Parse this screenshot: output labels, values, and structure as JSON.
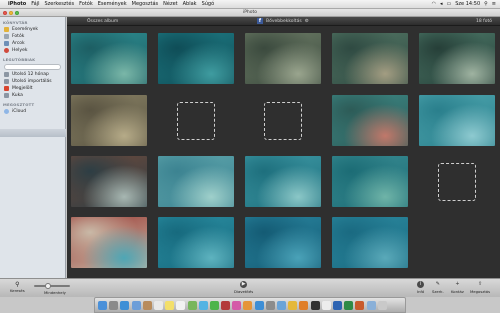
{
  "menubar": {
    "apple_icon": "apple-icon",
    "menus": [
      "iPhoto",
      "Fájl",
      "Szerkesztés",
      "Fotók",
      "Események",
      "Megosztás",
      "Nézet",
      "Ablak",
      "Súgó"
    ],
    "clock": "Sze 14:50"
  },
  "window": {
    "title": "iPhoto"
  },
  "sidebar": {
    "sections": [
      {
        "title": "KÖNYVTÁR",
        "items": [
          {
            "label": "Események",
            "icon": "events-icon",
            "color": "#e2b33a"
          },
          {
            "label": "Fotók",
            "icon": "photos-icon",
            "color": "#9aa6b3"
          },
          {
            "label": "Arcok",
            "icon": "faces-icon",
            "color": "#6d8fb7"
          },
          {
            "label": "Helyek",
            "icon": "places-icon",
            "color": "#d04a3c"
          }
        ]
      },
      {
        "title": "LEGUTÓBBIAK",
        "items": [
          {
            "label": "Utolsó 12 hónap",
            "icon": "calendar-icon",
            "color": "#8b96a3"
          },
          {
            "label": "Utolsó importálás",
            "icon": "import-icon",
            "color": "#8b96a3"
          },
          {
            "label": "Megjelölt",
            "icon": "flag-icon",
            "color": "#d9452f"
          },
          {
            "label": "Kuka",
            "icon": "trash-icon",
            "color": "#8b96a3"
          }
        ]
      },
      {
        "title": "MEGOSZTOTT",
        "items": [
          {
            "label": "iCloud",
            "icon": "icloud-icon",
            "color": "#8fb6e6"
          }
        ]
      }
    ]
  },
  "toolbar": {
    "album_name": "Összes album",
    "share_label": "Bővebbekkoltás",
    "count": "18 fotó"
  },
  "photos": [
    {
      "name": "photo-diver-1",
      "colors": [
        "#2e8f93",
        "#1d5e63",
        "#7ab7a8"
      ]
    },
    {
      "name": "photo-diver-2",
      "colors": [
        "#1f7c85",
        "#0f4d57",
        "#3f9ca0"
      ]
    },
    {
      "name": "photo-reef-1",
      "colors": [
        "#6f7e68",
        "#3b4a3e",
        "#9aa58e"
      ]
    },
    {
      "name": "photo-reef-2",
      "colors": [
        "#547765",
        "#2f4a42",
        "#a39d82"
      ]
    },
    {
      "name": "photo-reef-3",
      "colors": [
        "#4e7a6a",
        "#263f38",
        "#9fb3a1"
      ]
    },
    {
      "name": "photo-rocks-1",
      "colors": [
        "#8a8366",
        "#5a5442",
        "#b6ab88"
      ]
    },
    {
      "name": "photo-coral-1",
      "colors": [
        "#3d8a87",
        "#2d5b57",
        "#c1786a"
      ]
    },
    {
      "name": "photo-shallow-1",
      "colors": [
        "#4fa7b0",
        "#2a7f8c",
        "#8ecad0"
      ]
    },
    {
      "name": "photo-rock-diver",
      "colors": [
        "#6e4a3c",
        "#2d3e44",
        "#a7b7b2"
      ]
    },
    {
      "name": "photo-sand-1",
      "colors": [
        "#5fa6ad",
        "#3c8391",
        "#9fd0cb"
      ]
    },
    {
      "name": "photo-sand-2",
      "colors": [
        "#3f9aa6",
        "#1e6f7d",
        "#8bc7c7"
      ]
    },
    {
      "name": "photo-seagrass",
      "colors": [
        "#3a8d94",
        "#1c6c75",
        "#6fb4a8"
      ]
    },
    {
      "name": "photo-beach",
      "colors": [
        "#9a3a34",
        "#c9b9a7",
        "#4ea6b5"
      ]
    },
    {
      "name": "photo-open-water-1",
      "colors": [
        "#2b8fa3",
        "#176a7e",
        "#5eb3bf"
      ]
    },
    {
      "name": "photo-fish-school",
      "colors": [
        "#2a86a0",
        "#145b74",
        "#4aa2b8"
      ]
    },
    {
      "name": "photo-open-water-2",
      "colors": [
        "#2c8aa0",
        "#1a6a81",
        "#5aa9b9"
      ]
    }
  ],
  "bottombar": {
    "search": "Keresés",
    "zoom": "Mindenhely",
    "slideshow": "Diavetítés",
    "info": "Infó",
    "edit": "Szerk.",
    "add_to": "Kontáz",
    "share": "Megosztás"
  },
  "dock": {
    "apps": [
      {
        "name": "finder-icon",
        "color": "#4a90d9"
      },
      {
        "name": "launchpad-icon",
        "color": "#8a8a8a"
      },
      {
        "name": "safari-icon",
        "color": "#3d8fd6"
      },
      {
        "name": "mail-icon",
        "color": "#6d9ed8"
      },
      {
        "name": "contacts-icon",
        "color": "#b88b5b"
      },
      {
        "name": "calendar-icon",
        "color": "#e9e9e9"
      },
      {
        "name": "notes-icon",
        "color": "#f3df6a"
      },
      {
        "name": "reminders-icon",
        "color": "#f2f2f2"
      },
      {
        "name": "maps-icon",
        "color": "#78b65c"
      },
      {
        "name": "messages-icon",
        "color": "#52b3e3"
      },
      {
        "name": "facetime-icon",
        "color": "#4db44a"
      },
      {
        "name": "photo-booth-icon",
        "color": "#b33b3b"
      },
      {
        "name": "itunes-icon",
        "color": "#d45aa8"
      },
      {
        "name": "ibooks-icon",
        "color": "#e5953a"
      },
      {
        "name": "app-store-icon",
        "color": "#3d8ed6"
      },
      {
        "name": "preferences-icon",
        "color": "#8c8c8c"
      },
      {
        "name": "iphoto-icon",
        "color": "#6aa4d8"
      },
      {
        "name": "chrome-icon",
        "color": "#e5b83a"
      },
      {
        "name": "vlc-icon",
        "color": "#e07e28"
      },
      {
        "name": "terminal-icon",
        "color": "#333333"
      },
      {
        "name": "textedit-icon",
        "color": "#ededed"
      },
      {
        "name": "word-icon",
        "color": "#2e64b2"
      },
      {
        "name": "excel-icon",
        "color": "#2f8a46"
      },
      {
        "name": "powerpoint-icon",
        "color": "#c85a2c"
      },
      {
        "name": "downloads-icon",
        "color": "#8ab0d8"
      },
      {
        "name": "trash-icon",
        "color": "#c9c9c9"
      }
    ]
  }
}
